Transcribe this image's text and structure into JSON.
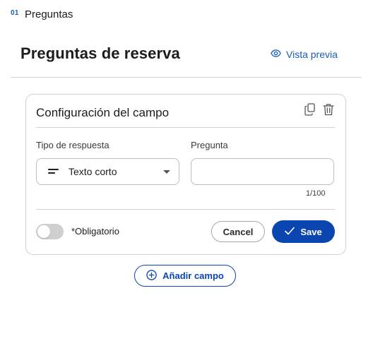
{
  "step": {
    "number": "01",
    "label": "Preguntas"
  },
  "header": {
    "title": "Preguntas de reserva",
    "preview_label": "Vista previa"
  },
  "card": {
    "title": "Configuración del campo",
    "type_label": "Tipo de respuesta",
    "type_value": "Texto corto",
    "question_label": "Pregunta",
    "question_value": "",
    "counter": "1/100",
    "required_label": "*Obligatorio",
    "required_on": false,
    "cancel_label": "Cancel",
    "save_label": "Save"
  },
  "add_field_label": "Añadir campo",
  "colors": {
    "accent": "#0b45b0",
    "link": "#1a5bbf",
    "toggle_off": "#cfcfcf"
  },
  "icons": [
    "eye-icon",
    "copy-icon",
    "trash-icon",
    "short-text-icon",
    "chevron-down-icon",
    "check-icon",
    "plus-circle-icon"
  ]
}
